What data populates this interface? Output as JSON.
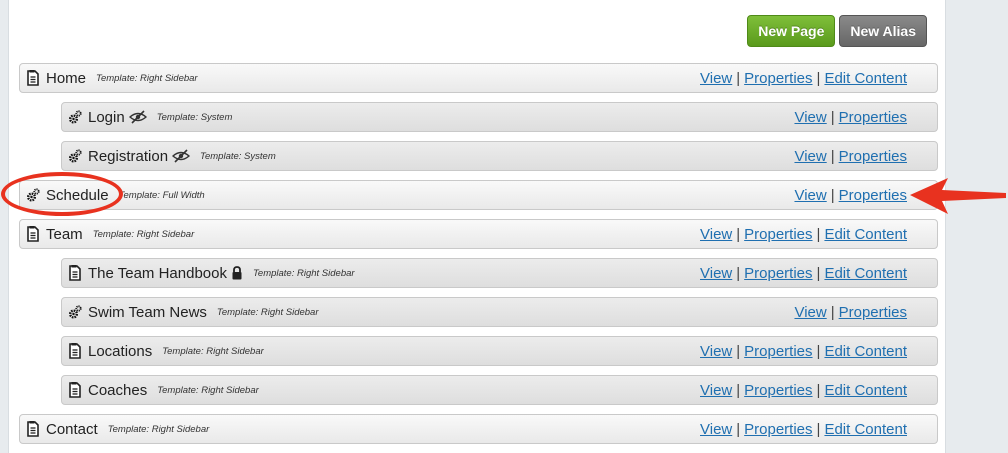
{
  "toolbar": {
    "new_page_label": "New Page",
    "new_alias_label": "New Alias"
  },
  "labels": {
    "view": "View",
    "properties": "Properties",
    "edit_content": "Edit Content",
    "separator": "|"
  },
  "pages": [
    {
      "title": "Home",
      "template": "Template: Right Sidebar",
      "icon": "page-icon",
      "badge": null,
      "actions": [
        "view",
        "properties",
        "edit_content"
      ]
    },
    {
      "title": "Login",
      "template": "Template: System",
      "icon": "gear-icon",
      "badge": "hidden-eye-icon",
      "actions": [
        "view",
        "properties"
      ]
    },
    {
      "title": "Registration",
      "template": "Template: System",
      "icon": "gear-icon",
      "badge": "hidden-eye-icon",
      "actions": [
        "view",
        "properties"
      ]
    },
    {
      "title": "Schedule",
      "template": "Template: Full Width",
      "icon": "gear-icon",
      "badge": null,
      "actions": [
        "view",
        "properties"
      ]
    },
    {
      "title": "Team",
      "template": "Template: Right Sidebar",
      "icon": "page-icon",
      "badge": null,
      "actions": [
        "view",
        "properties",
        "edit_content"
      ]
    },
    {
      "title": "The Team Handbook",
      "template": "Template: Right Sidebar",
      "icon": "page-icon",
      "badge": "lock-icon",
      "actions": [
        "view",
        "properties",
        "edit_content"
      ]
    },
    {
      "title": "Swim Team News",
      "template": "Template: Right Sidebar",
      "icon": "gear-icon",
      "badge": null,
      "actions": [
        "view",
        "properties"
      ]
    },
    {
      "title": "Locations",
      "template": "Template: Right Sidebar",
      "icon": "page-icon",
      "badge": null,
      "actions": [
        "view",
        "properties",
        "edit_content"
      ]
    },
    {
      "title": "Coaches",
      "template": "Template: Right Sidebar",
      "icon": "page-icon",
      "badge": null,
      "actions": [
        "view",
        "properties",
        "edit_content"
      ]
    },
    {
      "title": "Contact",
      "template": "Template: Right Sidebar",
      "icon": "page-icon",
      "badge": null,
      "actions": [
        "view",
        "properties",
        "edit_content"
      ]
    }
  ],
  "colors": {
    "link": "#1f6fb0",
    "new_page_button": "#6aab2a",
    "new_alias_button": "#777777",
    "annotation": "#e8321f"
  }
}
